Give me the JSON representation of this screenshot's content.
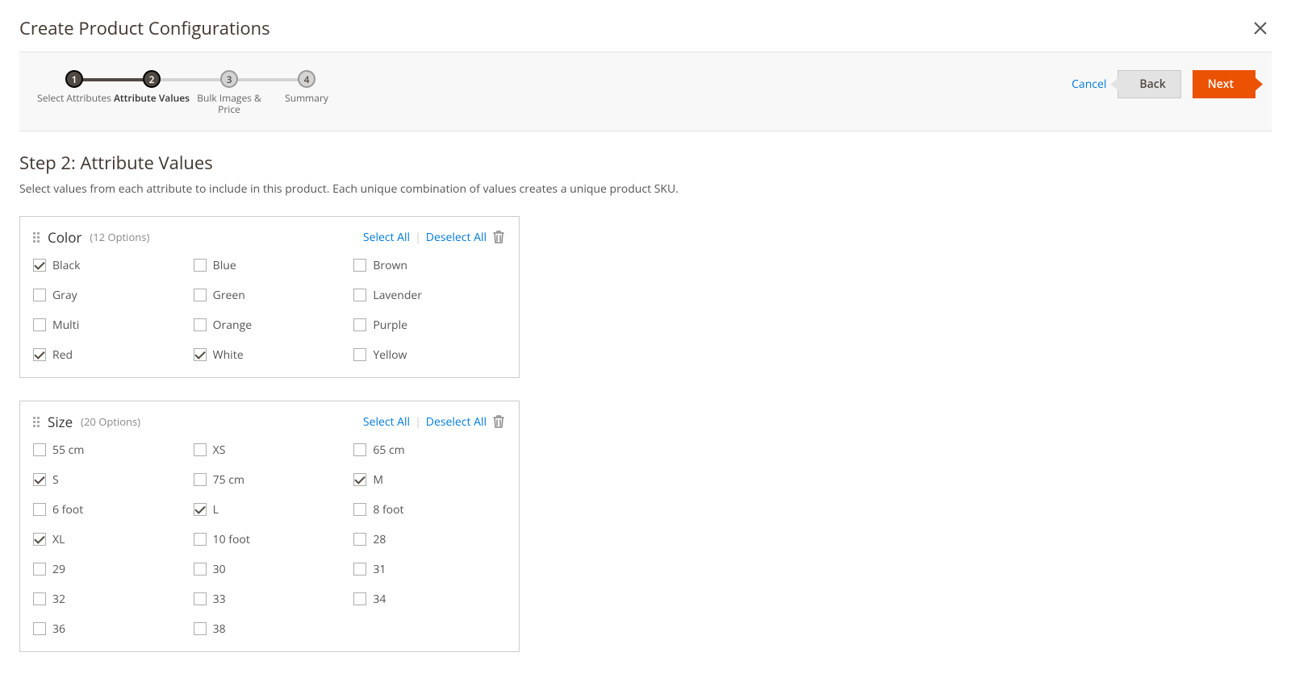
{
  "modal": {
    "title": "Create Product Configurations"
  },
  "steps": [
    {
      "num": "1",
      "label": "Select Attributes",
      "state": "done"
    },
    {
      "num": "2",
      "label": "Attribute Values",
      "state": "active"
    },
    {
      "num": "3",
      "label": "Bulk Images & Price",
      "state": "todo"
    },
    {
      "num": "4",
      "label": "Summary",
      "state": "todo"
    }
  ],
  "actions": {
    "cancel": "Cancel",
    "back": "Back",
    "next": "Next"
  },
  "heading": "Step 2: Attribute Values",
  "description": "Select values from each attribute to include in this product. Each unique combination of values creates a unique product SKU.",
  "labels": {
    "select_all": "Select All",
    "deselect_all": "Deselect All"
  },
  "attributes": [
    {
      "name": "Color",
      "count_label": "(12 Options)",
      "options": [
        {
          "label": "Black",
          "checked": true
        },
        {
          "label": "Blue",
          "checked": false
        },
        {
          "label": "Brown",
          "checked": false
        },
        {
          "label": "Gray",
          "checked": false
        },
        {
          "label": "Green",
          "checked": false
        },
        {
          "label": "Lavender",
          "checked": false
        },
        {
          "label": "Multi",
          "checked": false
        },
        {
          "label": "Orange",
          "checked": false
        },
        {
          "label": "Purple",
          "checked": false
        },
        {
          "label": "Red",
          "checked": true
        },
        {
          "label": "White",
          "checked": true
        },
        {
          "label": "Yellow",
          "checked": false
        }
      ]
    },
    {
      "name": "Size",
      "count_label": "(20 Options)",
      "options": [
        {
          "label": "55 cm",
          "checked": false
        },
        {
          "label": "XS",
          "checked": false
        },
        {
          "label": "65 cm",
          "checked": false
        },
        {
          "label": "S",
          "checked": true
        },
        {
          "label": "75 cm",
          "checked": false
        },
        {
          "label": "M",
          "checked": true
        },
        {
          "label": "6 foot",
          "checked": false
        },
        {
          "label": "L",
          "checked": true
        },
        {
          "label": "8 foot",
          "checked": false
        },
        {
          "label": "XL",
          "checked": true
        },
        {
          "label": "10 foot",
          "checked": false
        },
        {
          "label": "28",
          "checked": false
        },
        {
          "label": "29",
          "checked": false
        },
        {
          "label": "30",
          "checked": false
        },
        {
          "label": "31",
          "checked": false
        },
        {
          "label": "32",
          "checked": false
        },
        {
          "label": "33",
          "checked": false
        },
        {
          "label": "34",
          "checked": false
        },
        {
          "label": "36",
          "checked": false
        },
        {
          "label": "38",
          "checked": false
        }
      ]
    }
  ]
}
